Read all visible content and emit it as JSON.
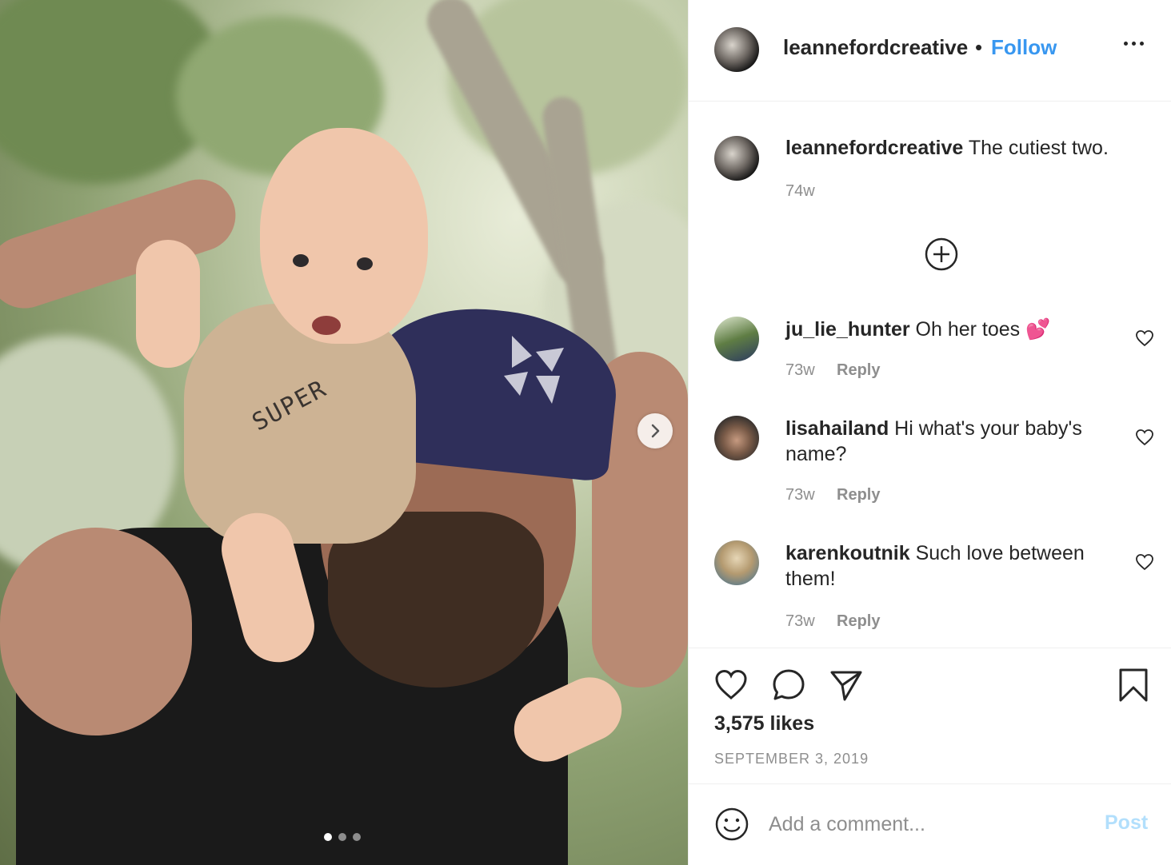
{
  "header": {
    "username": "leannefordcreative",
    "separator": "•",
    "follow_label": "Follow"
  },
  "caption": {
    "username": "leannefordcreative",
    "text": "The cutiest two.",
    "time": "74w"
  },
  "comments": [
    {
      "username": "ju_lie_hunter",
      "text": "Oh her toes 💕",
      "time": "73w",
      "reply_label": "Reply"
    },
    {
      "username": "lisahailand",
      "text": "Hi what's your baby's name?",
      "time": "73w",
      "reply_label": "Reply"
    },
    {
      "username": "karenkoutnik",
      "text": "Such love between them!",
      "time": "73w",
      "reply_label": "Reply"
    }
  ],
  "photo": {
    "shirt_text": "SUPER",
    "carousel": {
      "total": 3,
      "current": 1
    }
  },
  "stats": {
    "likes": "3,575 likes",
    "date": "SEPTEMBER 3, 2019"
  },
  "add_comment": {
    "placeholder": "Add a comment...",
    "post_label": "Post"
  },
  "colors": {
    "link": "#3897f0",
    "post_disabled": "#b2dffc",
    "muted": "#8e8e8e",
    "text": "#262626"
  },
  "icons": [
    "ellipsis-icon",
    "plus-circle-icon",
    "heart-icon",
    "comment-icon",
    "share-icon",
    "bookmark-icon",
    "emoji-icon",
    "chevron-right-icon"
  ]
}
